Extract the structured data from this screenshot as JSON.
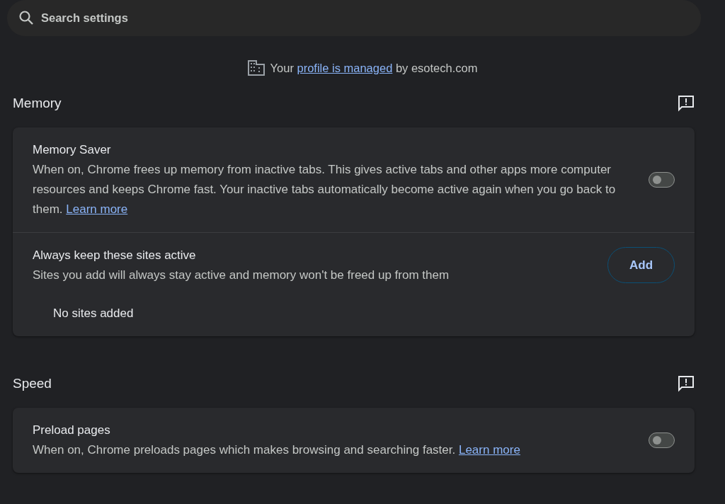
{
  "search": {
    "placeholder": "Search settings"
  },
  "managed_notice": {
    "prefix": "Your",
    "link": "profile is managed",
    "suffix": "by esotech.com"
  },
  "sections": [
    {
      "title": "Memory",
      "rows": [
        {
          "kind": "toggle",
          "title": "Memory Saver",
          "description": "When on, Chrome frees up memory from inactive tabs. This gives active tabs and other apps more computer resources and keeps Chrome fast. Your inactive tabs automatically become active again when you go back to them.",
          "link": "Learn more",
          "on": false
        },
        {
          "kind": "button",
          "title": "Always keep these sites active",
          "description": "Sites you add will always stay active and memory won't be freed up from them",
          "button": "Add"
        },
        {
          "kind": "note",
          "text": "No sites added"
        }
      ]
    },
    {
      "title": "Speed",
      "rows": [
        {
          "kind": "toggle",
          "title": "Preload pages",
          "description": "When on, Chrome preloads pages which makes browsing and searching faster.",
          "link": "Learn more",
          "on": false
        }
      ]
    }
  ]
}
